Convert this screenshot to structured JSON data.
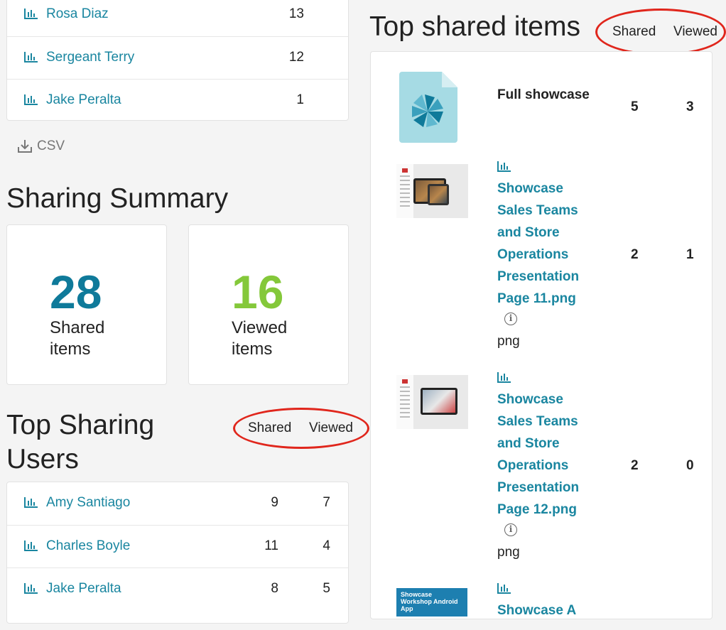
{
  "top_list": [
    {
      "name": "Rosa Diaz",
      "shared": "13"
    },
    {
      "name": "Sergeant Terry",
      "shared": "12"
    },
    {
      "name": "Jake Peralta",
      "shared": "1"
    }
  ],
  "csv_label": "CSV",
  "sharing_summary": {
    "title": "Sharing Summary",
    "shared_value": "28",
    "shared_label": "Shared items",
    "viewed_value": "16",
    "viewed_label": "Viewed items"
  },
  "top_users": {
    "title": "Top Sharing Users",
    "col_shared": "Shared",
    "col_viewed": "Viewed",
    "rows": [
      {
        "name": "Amy Santiago",
        "shared": "9",
        "viewed": "7"
      },
      {
        "name": "Charles Boyle",
        "shared": "11",
        "viewed": "4"
      },
      {
        "name": "Jake Peralta",
        "shared": "8",
        "viewed": "5"
      }
    ]
  },
  "top_items": {
    "title": "Top shared items",
    "col_shared": "Shared",
    "col_viewed": "Viewed",
    "rows": [
      {
        "name": "Full showcase",
        "shared": "5",
        "viewed": "3"
      },
      {
        "name": "Showcase Sales Teams and Store Operations Presentation Page 11.png",
        "ext": "png",
        "shared": "2",
        "viewed": "1"
      },
      {
        "name": "Showcase Sales Teams and Store Operations Presentation Page 12.png",
        "ext": "png",
        "shared": "2",
        "viewed": "0"
      },
      {
        "name": "Showcase A"
      }
    ],
    "thumb_text": "Showcase Workshop Android App"
  },
  "colors": {
    "accent": "#1a86a0",
    "shared_big": "#0f7a9a",
    "viewed_big": "#84c83a",
    "highlight": "#e0261c"
  }
}
